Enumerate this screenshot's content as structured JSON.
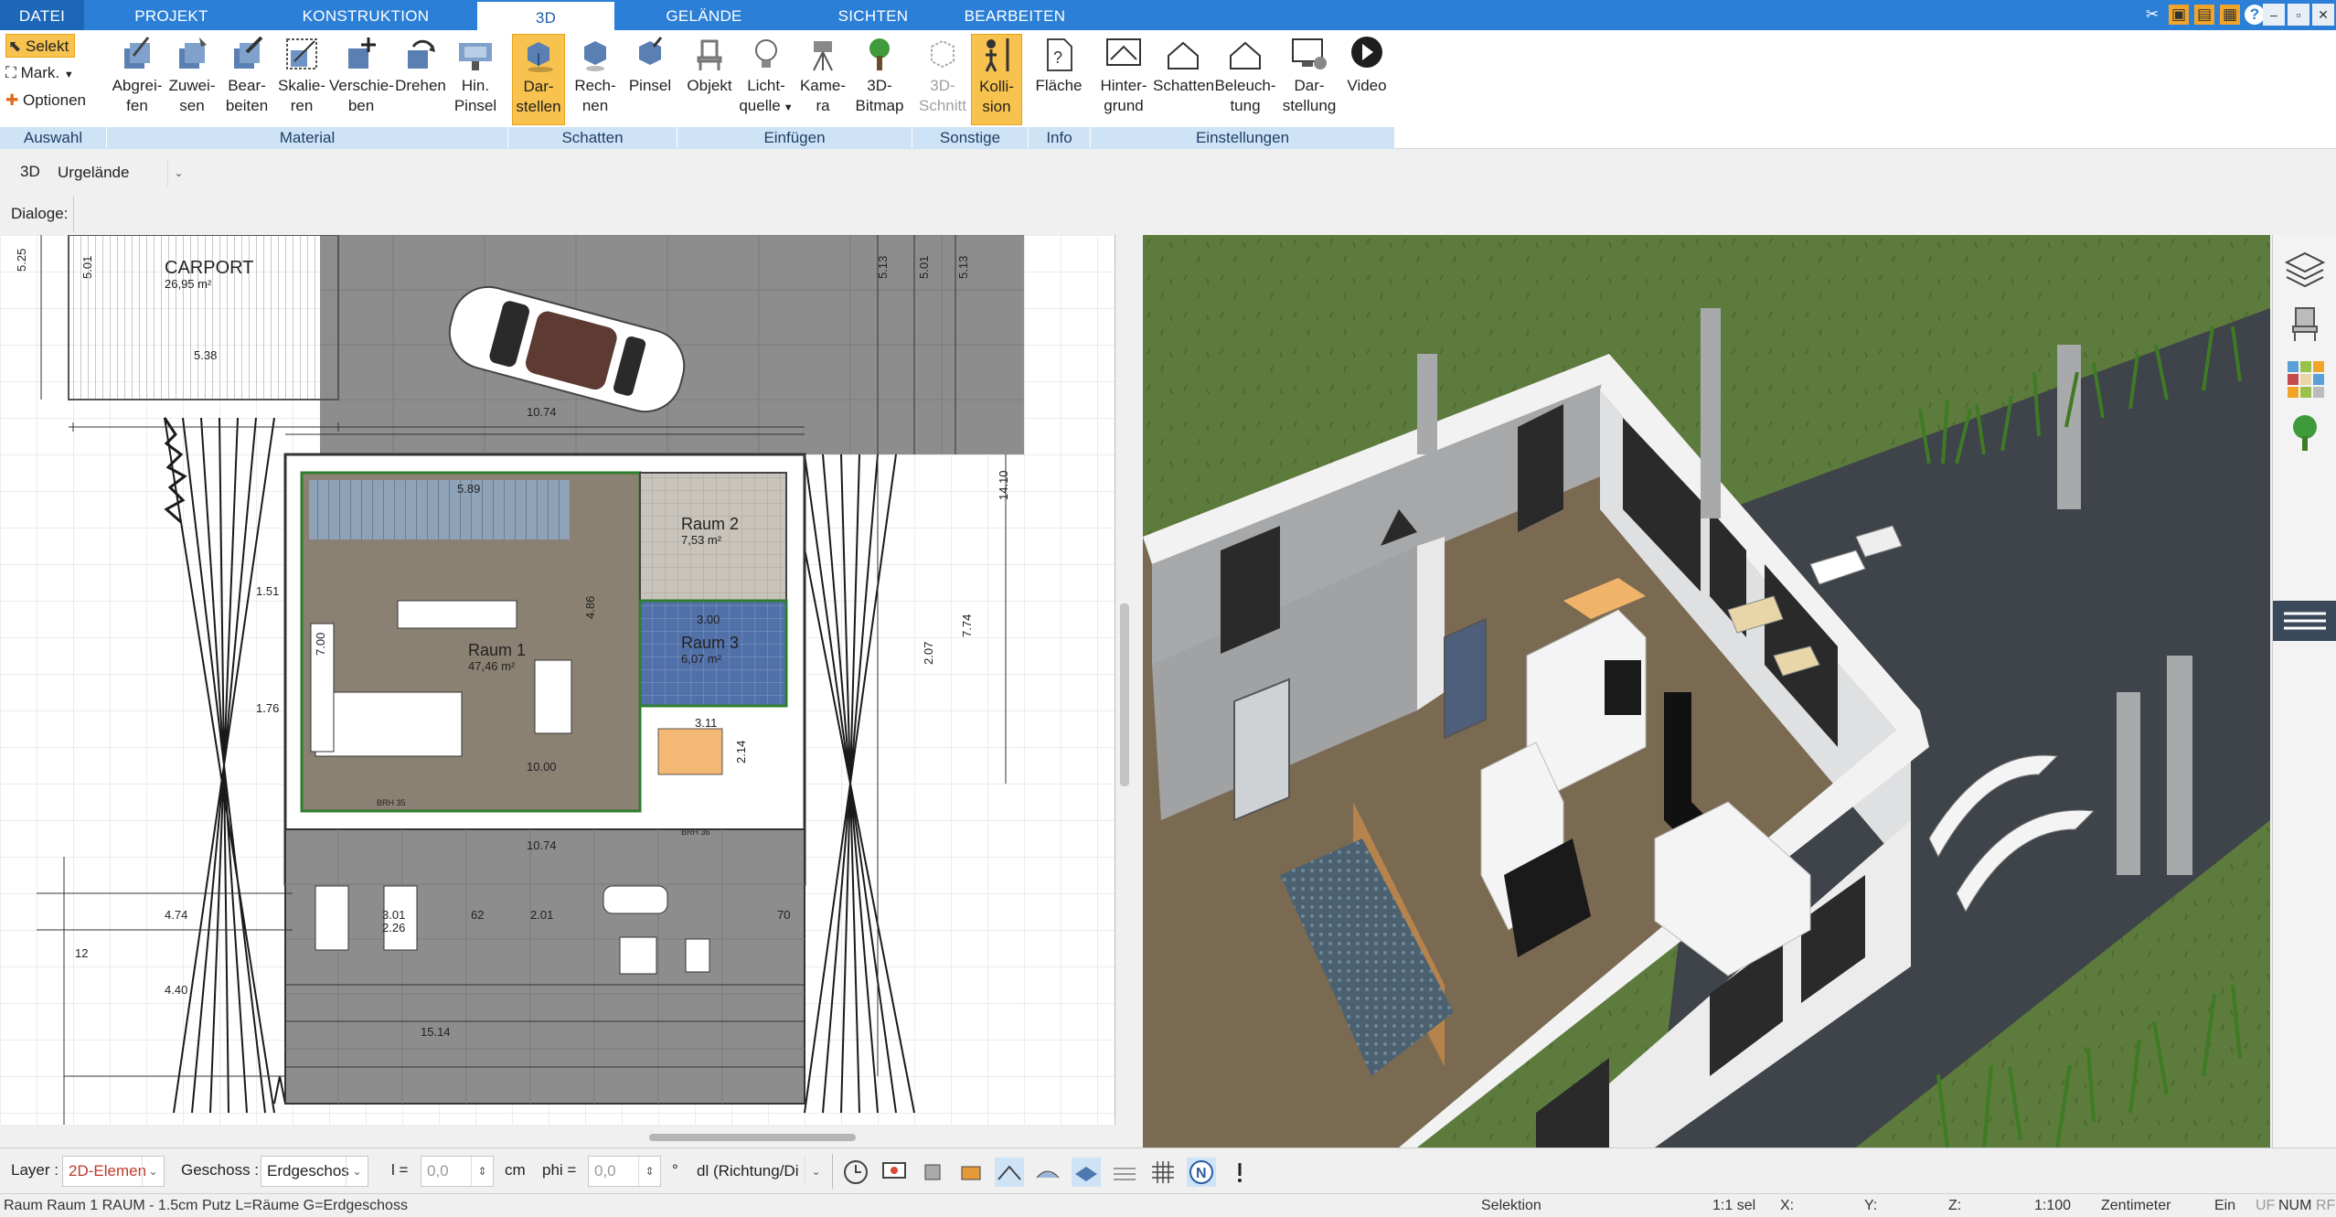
{
  "tabs": {
    "file": "DATEI",
    "project": "PROJEKT",
    "construction": "KONSTRUKTION",
    "threed": "3D",
    "terrain": "GELÄNDE",
    "views": "SICHTEN",
    "edit": "BEARBEITEN"
  },
  "ribbon": {
    "selection": {
      "select": "Selekt",
      "mark": "Mark.",
      "options": "Optionen",
      "group": "Auswahl"
    },
    "material": {
      "pick_1": "Abgrei-",
      "pick_2": "fen",
      "assign_1": "Zuwei-",
      "assign_2": "sen",
      "edit_1": "Bear-",
      "edit_2": "beiten",
      "scale_1": "Skalie-",
      "scale_2": "ren",
      "move_1": "Verschie-",
      "move_2": "ben",
      "rotate": "Drehen",
      "brush_1": "Hin.",
      "brush_2": "Pinsel",
      "group": "Material"
    },
    "shadow": {
      "display_1": "Dar-",
      "display_2": "stellen",
      "compute_1": "Rech-",
      "compute_2": "nen",
      "brush": "Pinsel",
      "group": "Schatten"
    },
    "insert": {
      "object": "Objekt",
      "light_1": "Licht-",
      "light_2": "quelle",
      "camera_1": "Kame-",
      "camera_2": "ra",
      "bitmap_1": "3D-",
      "bitmap_2": "Bitmap",
      "group": "Einfügen"
    },
    "misc": {
      "cut_1": "3D-",
      "cut_2": "Schnitt",
      "collision_1": "Kolli-",
      "collision_2": "sion",
      "group": "Sonstige"
    },
    "info": {
      "area": "Fläche",
      "group": "Info"
    },
    "settings": {
      "bg_1": "Hinter-",
      "bg_2": "grund",
      "shadow": "Schatten",
      "light_1": "Beleuch-",
      "light_2": "tung",
      "display_1": "Dar-",
      "display_2": "stellung",
      "video": "Video",
      "group": "Einstellungen"
    }
  },
  "row3d": {
    "label": "3D",
    "terrain_value": "Urgelände"
  },
  "dialogs": {
    "label": "Dialoge:"
  },
  "plan": {
    "carport": "CARPORT",
    "carport_area": "26,95 m²",
    "room1": "Raum 1",
    "room1_area": "47,46 m²",
    "room2": "Raum 2",
    "room2_area": "7,53 m²",
    "room3": "Raum 3",
    "room3_area": "6,07 m²",
    "dims": [
      "5.25",
      "5.01",
      "5.38",
      "10.74",
      "5.13",
      "5.01",
      "5.13",
      "14.10",
      "5.89",
      "4.86",
      "10.00",
      "10.74",
      "3.00",
      "3.01",
      "2.26",
      "2.01",
      "15.14",
      "4.40",
      "7.74",
      "2.14",
      "2.07",
      "62",
      "70",
      "12",
      "4.74",
      "3.11",
      "1.76",
      "1.51",
      "7.00",
      "BRH 35",
      "BRH 36"
    ]
  },
  "inputbar": {
    "layer_label": "Layer :",
    "layer_value": "2D-Elemen",
    "floor_label": "Geschoss :",
    "floor_value": "Erdgeschos",
    "l_label": "l =",
    "l_value": "0,0",
    "l_unit": "cm",
    "phi_label": "phi =",
    "phi_value": "0,0",
    "phi_unit": "°",
    "dl_value": "dl (Richtung/Di"
  },
  "status": {
    "info": "Raum Raum 1 RAUM - 1.5cm Putz L=Räume G=Erdgeschoss",
    "mode": "Selektion",
    "sel": "1:1 sel",
    "x": "X:",
    "y": "Y:",
    "z": "Z:",
    "scale": "1:100",
    "unit": "Zentimeter",
    "ein": "Ein",
    "uf": "UF",
    "num": "NUM",
    "rf": "RF"
  },
  "colors": {
    "tab_blue": "#2b7fd6",
    "group_bar": "#cfe3f6",
    "active": "#f7c24e",
    "grass": "#5c7a3c",
    "paving": "#3d4148"
  }
}
